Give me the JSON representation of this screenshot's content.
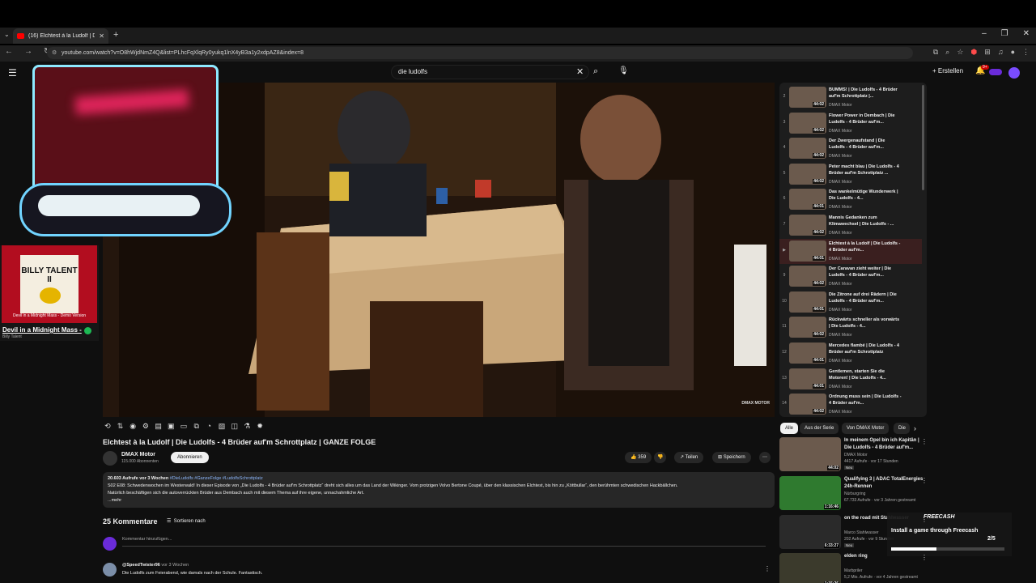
{
  "browser": {
    "tab_title": "(16) Elchtest à la Ludolf | Di",
    "url": "youtube.com/watch?v=O8hWjdNmZ4Q&list=PLhcFqXlqRy0yukq1lnX4yB3a1y2xdpAZ8&index=8",
    "new_tab": "+",
    "tab_close": "✕"
  },
  "header": {
    "search_query": "die ludolfs",
    "create_label": "Erstellen",
    "notification_count": "9+"
  },
  "music": {
    "album_title": "BILLY TALENT II",
    "album_caption": "Devil in a Midnight Mass - Demo Version",
    "track": "Devil in a Midnight Mass -",
    "artist": "Billy Talent"
  },
  "player": {
    "watermark": "DMAX MOTOR"
  },
  "video": {
    "title": "Elchtest à la Ludolf | Die Ludolfs - 4 Brüder auf'm Schrottplatz | GANZE FOLGE",
    "channel": "DMAX Motor",
    "subscribers": "115.000 Abonnenten",
    "subscribe_label": "Abonnieren",
    "likes": "359",
    "share_label": "Teilen",
    "save_label": "Speichern",
    "views_age": "20.603 Aufrufe  vor 3 Wochen",
    "tags": "#DieLudolfs #GanzeFolge #LudolfsSchrottplatz",
    "description_1": "S02 E08: Schwedenwochen im Westerwald! In dieser Episode von „Die Ludolfs - 4 Brüder auf'm Schrottplatz“ dreht sich alles um das Land der Wikinger. Vom protzigen Volvo Bertone Coupé, über den klassischen Elchtest, bis hin zu „Köttbullar“, den berühmten schwedischen Hackbällchen.",
    "description_2": "Natürlich beschäftigen sich die autoverrückten Brüder aus Dembach auch mit diesem Thema auf ihre eigene, unnachahmliche Art.",
    "more_label": "...mehr"
  },
  "comments": {
    "count_label": "25 Kommentare",
    "sort_label": "Sortieren nach",
    "input_placeholder": "Kommentar hinzufügen...",
    "first": {
      "user": "@SpeedTwister96",
      "age": "vor 3 Wochen",
      "text": "Die Ludolfs zum Feierabend, wie damals nach der Schule. Fantastisch."
    }
  },
  "playlist": {
    "items": [
      {
        "num": "2",
        "title": "BUMMS! | Die Ludolfs - 4 Brüder auf'm Schrottplatz |...",
        "channel": "DMAX Motor",
        "duration": "44:02"
      },
      {
        "num": "3",
        "title": "Flower Power in Dembach | Die Ludolfs - 4 Brüder auf'm...",
        "channel": "DMAX Motor",
        "duration": "44:02"
      },
      {
        "num": "4",
        "title": "Der Zwergenaufstand | Die Ludolfs - 4 Brüder auf'm...",
        "channel": "DMAX Motor",
        "duration": "44:02"
      },
      {
        "num": "5",
        "title": "Peter macht blau | Die Ludolfs - 4 Brüder auf'm Schrottplatz ...",
        "channel": "DMAX Motor",
        "duration": "44:02"
      },
      {
        "num": "6",
        "title": "Das wankelmütige Wunderwerk | Die Ludolfs - 4...",
        "channel": "DMAX Motor",
        "duration": "44:01"
      },
      {
        "num": "7",
        "title": "Mannis Gedanken zum Klimawechsel | Die Ludolfs - ...",
        "channel": "DMAX Motor",
        "duration": "44:02"
      },
      {
        "num": "▶",
        "title": "Elchtest à la Ludolf | Die Ludolfs - 4 Brüder auf'm...",
        "channel": "DMAX Motor",
        "duration": "44:01"
      },
      {
        "num": "9",
        "title": "Der Caravan zieht weiter | Die Ludolfs - 4 Brüder auf'm...",
        "channel": "DMAX Motor",
        "duration": "44:02"
      },
      {
        "num": "10",
        "title": "Die Zitrone auf drei Rädern | Die Ludolfs - 4 Brüder auf'm...",
        "channel": "DMAX Motor",
        "duration": "44:01"
      },
      {
        "num": "11",
        "title": "Rückwärts schneller als vorwärts | Die Ludolfs - 4...",
        "channel": "DMAX Motor",
        "duration": "44:02"
      },
      {
        "num": "12",
        "title": "Mercedes flambé | Die Ludolfs - 4 Brüder auf'm Schrottplatz",
        "channel": "DMAX Motor",
        "duration": "44:01"
      },
      {
        "num": "13",
        "title": "Gentlemen, starten Sie die Motoren! | Die Ludolfs - 4...",
        "channel": "DMAX Motor",
        "duration": "44:01"
      },
      {
        "num": "14",
        "title": "Ordnung muss sein | Die Ludolfs - 4 Brüder auf'm...",
        "channel": "DMAX Motor",
        "duration": "44:02"
      }
    ]
  },
  "chips": [
    "Alle",
    "Aus der Serie",
    "Von DMAX Motor",
    "Die"
  ],
  "recommendations": [
    {
      "title": "In meinem Opel bin ich Kapitän | Die Ludolfs - 4 Brüder auf'm...",
      "channel": "DMAX Motor",
      "meta": "4417 Aufrufe · vor 17 Stunden",
      "badge": "Neu",
      "duration": "44:02",
      "color": "#6b5a4d"
    },
    {
      "title": "Qualifying 3 | ADAC TotalEnergies 24h-Rennen",
      "channel": "Nürburgring",
      "meta": "67.733 Aufrufe · vor 3 Jahren gestreamt",
      "badge": "",
      "duration": "1:16:46",
      "color": "#2f7a2f"
    },
    {
      "title": "on the road mit Stahlwasser",
      "channel": "Marco Stahlwasser",
      "meta": "202 Aufrufe · vor 9 Stunden",
      "badge": "Neu",
      "duration": "6:33:27",
      "color": "#2a2a2a"
    },
    {
      "title": "elden ring",
      "channel": "Marbpriler",
      "meta": "5,2 Mio. Aufrufe · vor 4 Jahren gestreamt",
      "badge": "",
      "duration": "1:15:26",
      "color": "#3b3a2c"
    }
  ],
  "freecash": {
    "brand": "FREECASH",
    "message": "Install a game through Freecash",
    "step": "2/5",
    "progress": 0.4
  }
}
